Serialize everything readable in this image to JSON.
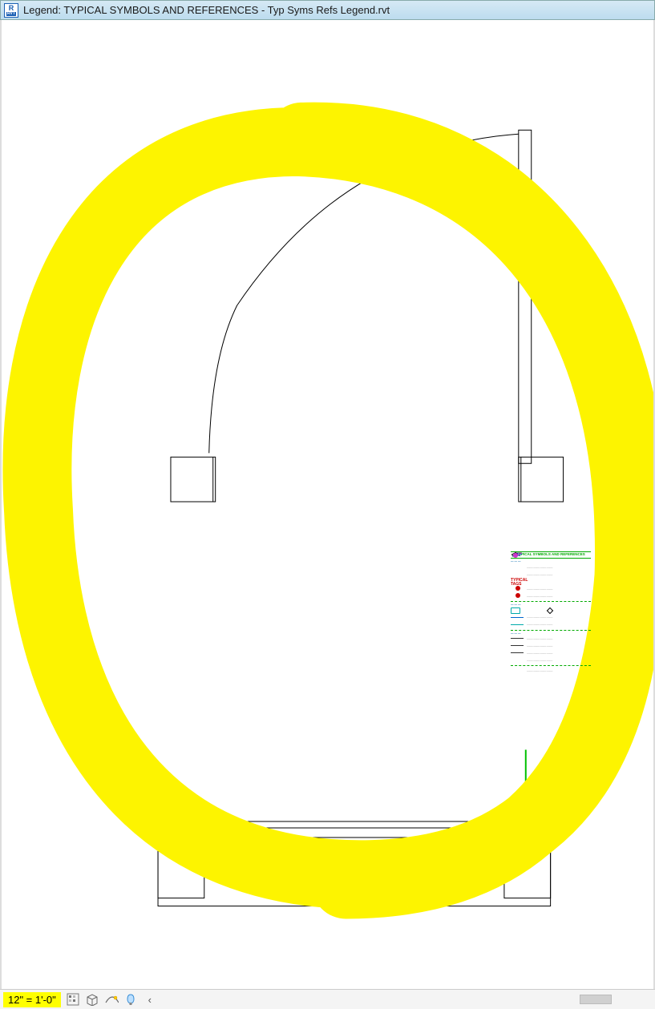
{
  "titlebar": {
    "app_icon_top": "R",
    "app_icon_bottom": "RVT",
    "title": "Legend: TYPICAL SYMBOLS AND REFERENCES - Typ Syms Refs Legend.rvt"
  },
  "legend_preview": {
    "title": "TYPICAL SYMBOLS AND REFERENCES",
    "sub_typtags": "TYPICAL TAGS",
    "row_text": "—— —— —— ——"
  },
  "statusbar": {
    "scale": "12\" = 1'-0\"",
    "icons": {
      "detail_level": "detail-level-icon",
      "visual_style": "visual-style-icon",
      "sun_path": "sun-path-icon",
      "reveal": "reveal-hidden-icon",
      "expand": "‹"
    }
  }
}
